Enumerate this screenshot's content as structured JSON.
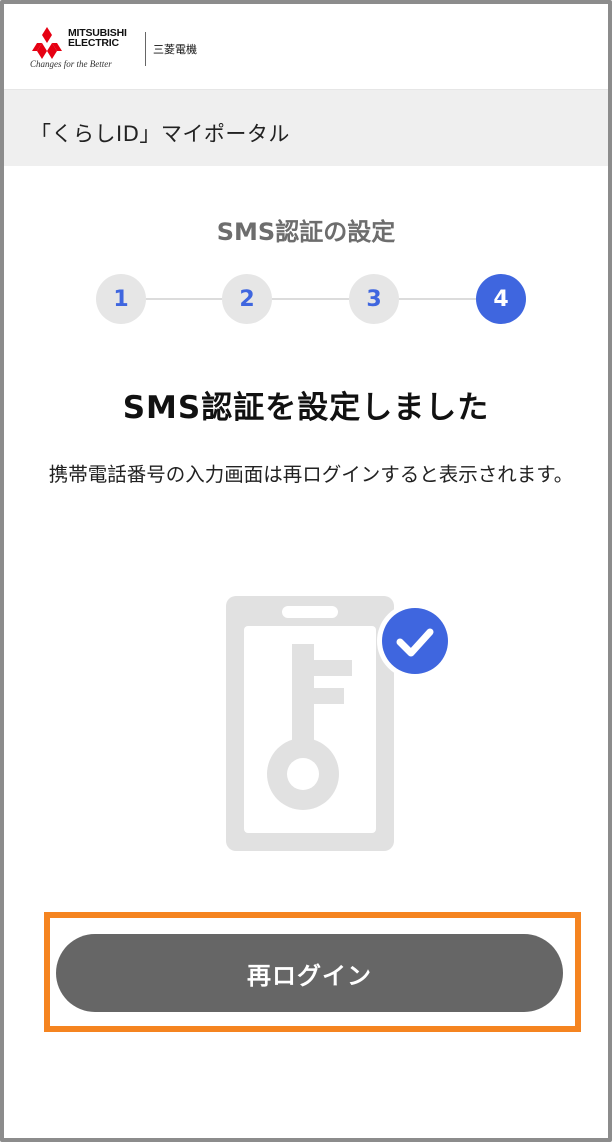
{
  "header": {
    "logo_name": "MITSUBISHI\nELECTRIC",
    "logo_tagline": "Changes for the Better",
    "logo_jp": "三菱電機"
  },
  "portal": {
    "title": "「くらしID」マイポータル"
  },
  "setup": {
    "title": "SMS認証の設定",
    "steps": [
      "1",
      "2",
      "3",
      "4"
    ],
    "active_step": 4
  },
  "main": {
    "heading": "SMS認証を設定しました",
    "description": "携帯電話番号の入力画面は再ログインすると表示されます。"
  },
  "actions": {
    "relogin_label": "再ログイン"
  },
  "colors": {
    "accent": "#3f66df",
    "step_inactive_bg": "#e6e6e6",
    "button_bg": "#666666",
    "highlight": "#f58420",
    "portal_bar": "#efefef"
  },
  "icons": {
    "logo": "mitsubishi-three-diamonds-icon",
    "illustration": "key-card-icon",
    "check": "check-circle-icon"
  }
}
